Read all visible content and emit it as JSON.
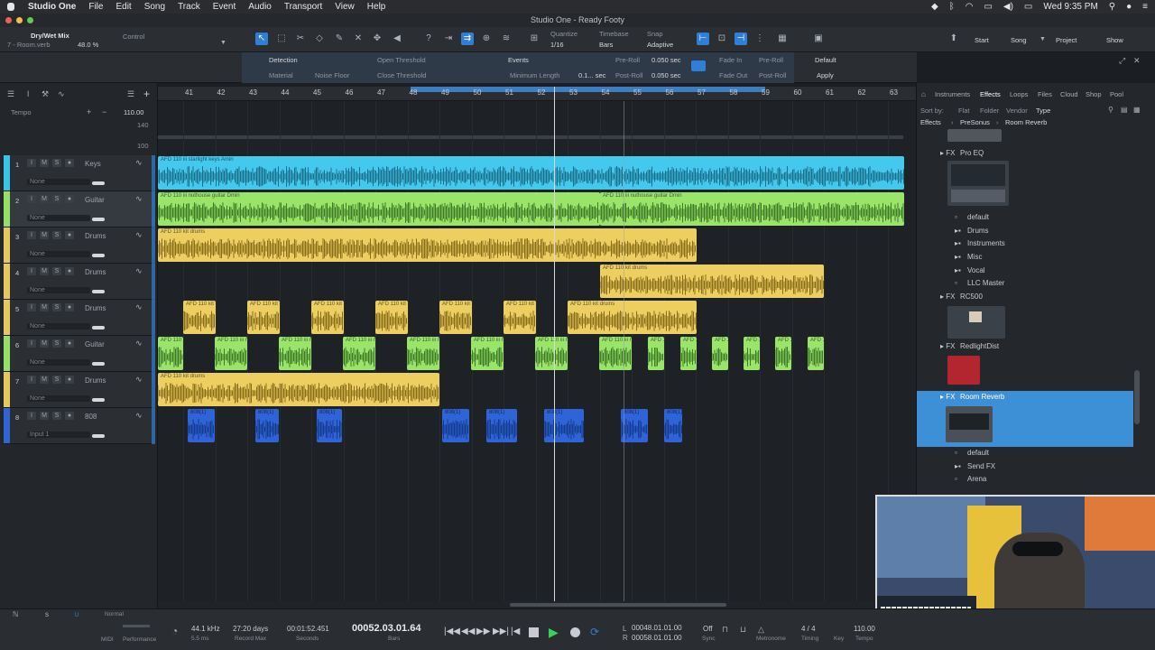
{
  "menubar": {
    "app_name": "Studio One",
    "items": [
      "File",
      "Edit",
      "Song",
      "Track",
      "Event",
      "Audio",
      "Transport",
      "View",
      "Help"
    ],
    "clock": "Wed 9:35 PM"
  },
  "window": {
    "title": "Studio One - Ready Footy"
  },
  "toolbar": {
    "track_name": "Dry/Wet Mix",
    "track_sub": "7 - Room.verb",
    "value": "48.0 %",
    "control_label": "Control",
    "quantize_label": "Quantize",
    "quantize_value": "1/16",
    "timebase_label": "Timebase",
    "timebase_value": "Bars",
    "snap_label": "Snap",
    "snap_value": "Adaptive",
    "start_label": "Start",
    "song_label": "Song",
    "project_label": "Project",
    "show_label": "Show"
  },
  "subbar": {
    "detection_label": "Detection",
    "material_label": "Material",
    "noise_floor_label": "Noise Floor",
    "open_threshold_label": "Open Threshold",
    "close_threshold_label": "Close Threshold",
    "events_label": "Events",
    "min_length_label": "Minimum Length",
    "min_length_value": "0.1... sec",
    "pre_roll_label": "Pre-Roll",
    "pre_roll_value": "0.050 sec",
    "post_roll_label": "Post-Roll",
    "post_roll_value": "0.050 sec",
    "fade_in_label": "Fade In",
    "fade_out_label": "Fade Out",
    "pre_roll2_label": "Pre-Roll",
    "post_roll2_label": "Post-Roll",
    "default_label": "Default",
    "apply_label": "Apply"
  },
  "ruler": [
    "41",
    "42",
    "43",
    "44",
    "45",
    "46",
    "47",
    "48",
    "49",
    "50",
    "51",
    "52",
    "53",
    "54",
    "55",
    "56",
    "57",
    "58",
    "59",
    "60",
    "61",
    "62",
    "63"
  ],
  "tempo": {
    "label": "Tempo",
    "value": "110.00",
    "max": "140",
    "min": "100"
  },
  "tracks": [
    {
      "num": "1",
      "name": "Keys",
      "sub": "None",
      "color": "#36c4ea"
    },
    {
      "num": "2",
      "name": "Guitar",
      "sub": "None",
      "color": "#94e062"
    },
    {
      "num": "3",
      "name": "Drums",
      "sub": "None",
      "color": "#e8c85a"
    },
    {
      "num": "4",
      "name": "Drums",
      "sub": "None",
      "color": "#e8c85a"
    },
    {
      "num": "5",
      "name": "Drums",
      "sub": "None",
      "color": "#e8c85a"
    },
    {
      "num": "6",
      "name": "Guitar",
      "sub": "None",
      "color": "#94e062"
    },
    {
      "num": "7",
      "name": "Drums",
      "sub": "None",
      "color": "#e8c85a"
    },
    {
      "num": "8",
      "name": "808",
      "sub": "Input 1",
      "color": "#2f63d8"
    }
  ],
  "clip_labels": {
    "keys": "AFD 110 iii starlight keys Amin",
    "guitar": "AFD 110 iii nuthouse guitar Dmin",
    "drums": "AFD 110 kit drums",
    "eight": "808(1)"
  },
  "browser": {
    "tabs": [
      "Instruments",
      "Effects",
      "Loops",
      "Files",
      "Cloud",
      "Shop",
      "Pool"
    ],
    "active_tab": "Effects",
    "sort_label": "Sort by:",
    "sort_options": [
      "Flat",
      "Folder",
      "Vendor",
      "Type"
    ],
    "breadcrumb": [
      "Effects",
      "PreSonus",
      "Room Reverb"
    ],
    "items": [
      {
        "label": "Pro EQ",
        "kind": "fx"
      },
      {
        "label": "default",
        "kind": "preset"
      },
      {
        "label": "Drums",
        "kind": "folder"
      },
      {
        "label": "Instruments",
        "kind": "folder"
      },
      {
        "label": "Misc",
        "kind": "folder"
      },
      {
        "label": "Vocal",
        "kind": "folder"
      },
      {
        "label": "LLC Master",
        "kind": "preset"
      },
      {
        "label": "RC500",
        "kind": "fx"
      },
      {
        "label": "RedlightDist",
        "kind": "fx"
      },
      {
        "label": "Room Reverb",
        "kind": "fx"
      },
      {
        "label": "default",
        "kind": "preset"
      },
      {
        "label": "Send FX",
        "kind": "folder"
      },
      {
        "label": "Arena",
        "kind": "preset"
      }
    ]
  },
  "transport": {
    "sample_rate": "44.1 kHz",
    "record_time": "27:20 days",
    "record_max_label": "Record Max",
    "seconds_time": "00:01:52.451",
    "seconds_label": "Seconds",
    "bars_time": "00052.03.01.64",
    "bars_label": "Bars",
    "loop_start": "00048.01.01.00",
    "loop_end": "00058.01.01.00",
    "off_label": "Off",
    "sync_label": "Sync",
    "metronome_label": "Metronome",
    "timing_label": "Timing",
    "time_sig": "4 / 4",
    "key_label": "Key",
    "tempo_value": "110.00",
    "tempo_label": "Tempo",
    "perf_label": "Performance",
    "midi_label": "MIDI",
    "ms_value": "5.5 ms",
    "normal_label": "Normal"
  }
}
